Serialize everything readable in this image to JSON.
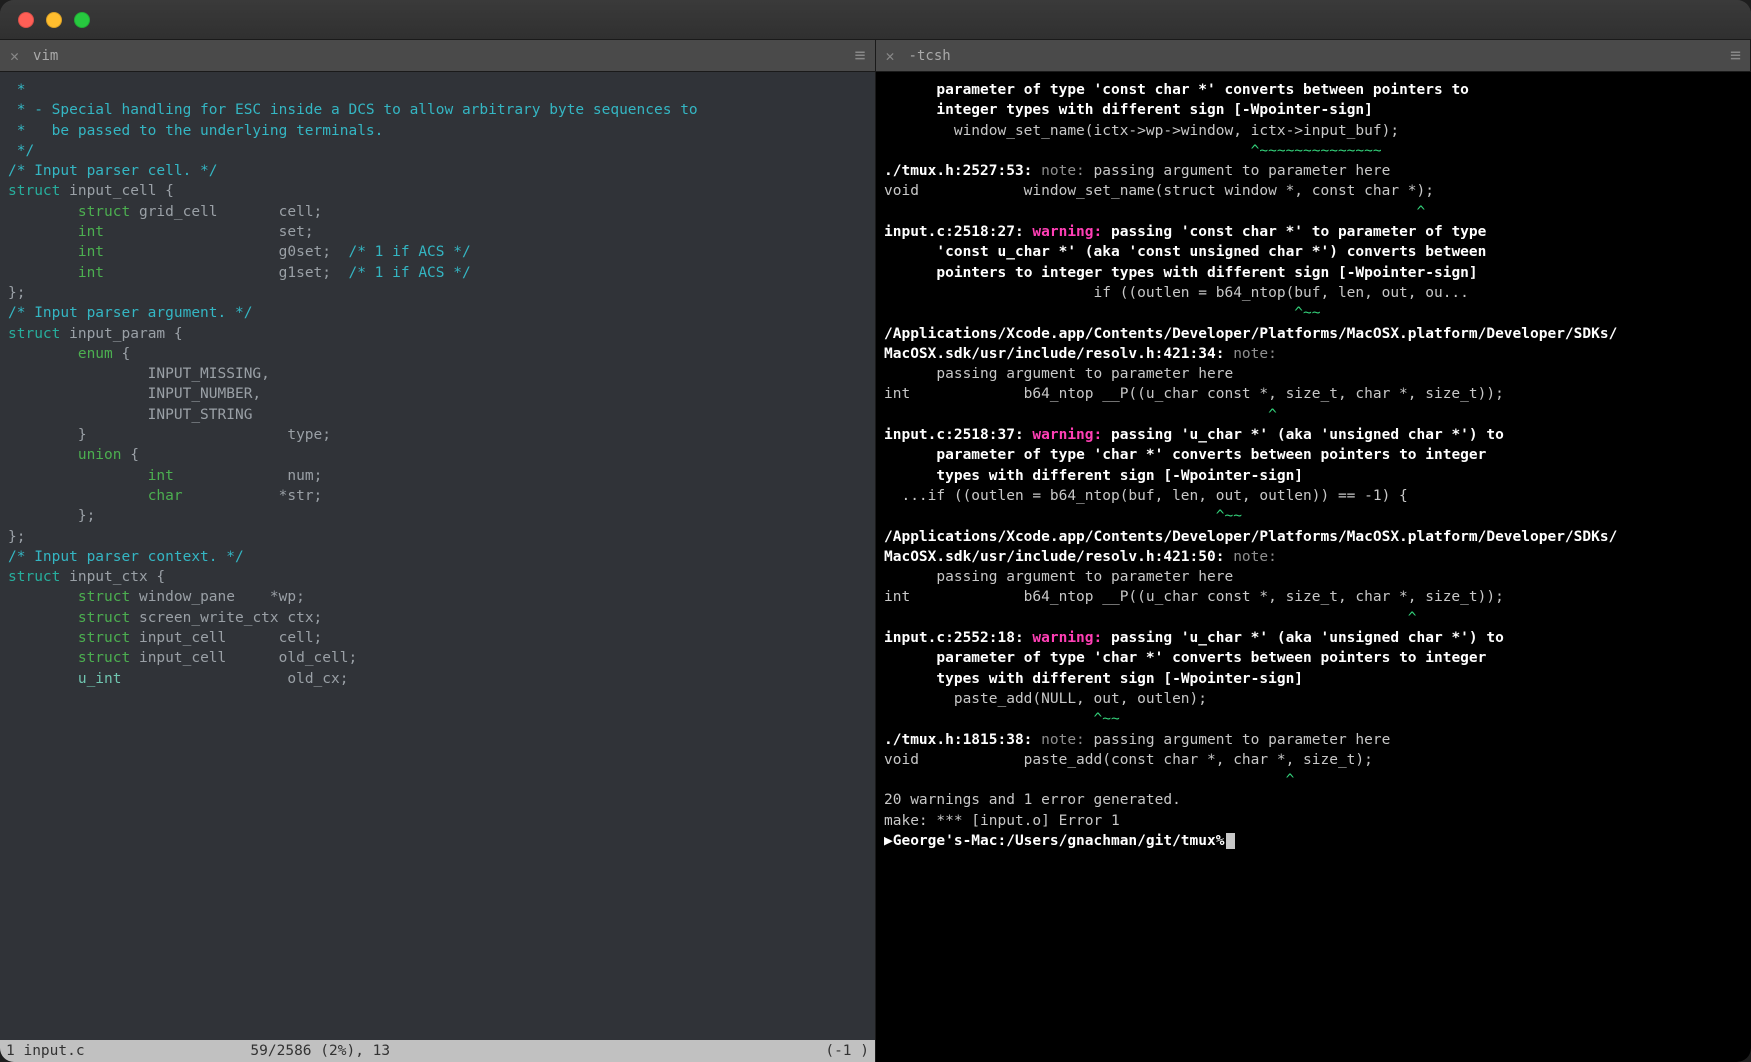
{
  "tabs": {
    "left_label": "vim",
    "right_label": "-tcsh"
  },
  "vim": {
    "code_lines": [
      {
        "class": "c-comment",
        "text": " *"
      },
      {
        "class": "c-comment",
        "text": " * - Special handling for ESC inside a DCS to allow arbitrary byte sequences to"
      },
      {
        "class": "c-comment",
        "text": " *   be passed to the underlying terminals."
      },
      {
        "class": "c-comment",
        "text": " */"
      },
      {
        "class": "",
        "text": ""
      },
      {
        "class": "c-comment",
        "text": "/* Input parser cell. */"
      },
      {
        "segments": [
          {
            "class": "c-struct",
            "text": "struct"
          },
          {
            "class": "c-gray",
            "text": " input_cell {"
          }
        ]
      },
      {
        "segments": [
          {
            "class": "",
            "text": "        "
          },
          {
            "class": "c-keyword",
            "text": "struct"
          },
          {
            "class": "c-gray",
            "text": " grid_cell       cell;"
          }
        ]
      },
      {
        "segments": [
          {
            "class": "",
            "text": "        "
          },
          {
            "class": "c-keyword",
            "text": "int"
          },
          {
            "class": "c-gray",
            "text": "                    set;"
          }
        ]
      },
      {
        "segments": [
          {
            "class": "",
            "text": "        "
          },
          {
            "class": "c-keyword",
            "text": "int"
          },
          {
            "class": "c-gray",
            "text": "                    g0set;  "
          },
          {
            "class": "c-comment",
            "text": "/* 1 if ACS */"
          }
        ]
      },
      {
        "segments": [
          {
            "class": "",
            "text": "        "
          },
          {
            "class": "c-keyword",
            "text": "int"
          },
          {
            "class": "c-gray",
            "text": "                    g1set;  "
          },
          {
            "class": "c-comment",
            "text": "/* 1 if ACS */"
          }
        ]
      },
      {
        "class": "c-gray",
        "text": "};"
      },
      {
        "class": "",
        "text": ""
      },
      {
        "class": "c-comment",
        "text": "/* Input parser argument. */"
      },
      {
        "segments": [
          {
            "class": "c-struct",
            "text": "struct"
          },
          {
            "class": "c-gray",
            "text": " input_param {"
          }
        ]
      },
      {
        "segments": [
          {
            "class": "",
            "text": "        "
          },
          {
            "class": "c-keyword",
            "text": "enum"
          },
          {
            "class": "c-gray",
            "text": " {"
          }
        ]
      },
      {
        "class": "c-gray",
        "text": "                INPUT_MISSING,"
      },
      {
        "class": "c-gray",
        "text": "                INPUT_NUMBER,"
      },
      {
        "class": "c-gray",
        "text": "                INPUT_STRING"
      },
      {
        "class": "c-gray",
        "text": "        }                       type;"
      },
      {
        "segments": [
          {
            "class": "",
            "text": "        "
          },
          {
            "class": "c-keyword",
            "text": "union"
          },
          {
            "class": "c-gray",
            "text": " {"
          }
        ]
      },
      {
        "segments": [
          {
            "class": "",
            "text": "                "
          },
          {
            "class": "c-keyword",
            "text": "int"
          },
          {
            "class": "c-gray",
            "text": "             num;"
          }
        ]
      },
      {
        "segments": [
          {
            "class": "",
            "text": "                "
          },
          {
            "class": "c-keyword",
            "text": "char"
          },
          {
            "class": "c-gray",
            "text": "           *str;"
          }
        ]
      },
      {
        "class": "c-gray",
        "text": "        };"
      },
      {
        "class": "c-gray",
        "text": "};"
      },
      {
        "class": "",
        "text": ""
      },
      {
        "class": "c-comment",
        "text": "/* Input parser context. */"
      },
      {
        "segments": [
          {
            "class": "c-struct",
            "text": "struct"
          },
          {
            "class": "c-gray",
            "text": " input_ctx {"
          }
        ]
      },
      {
        "segments": [
          {
            "class": "",
            "text": "        "
          },
          {
            "class": "c-keyword",
            "text": "struct"
          },
          {
            "class": "c-gray",
            "text": " window_pane    *wp;"
          }
        ]
      },
      {
        "segments": [
          {
            "class": "",
            "text": "        "
          },
          {
            "class": "c-keyword",
            "text": "struct"
          },
          {
            "class": "c-gray",
            "text": " screen_write_ctx ctx;"
          }
        ]
      },
      {
        "class": "",
        "text": ""
      },
      {
        "segments": [
          {
            "class": "",
            "text": "        "
          },
          {
            "class": "c-keyword",
            "text": "struct"
          },
          {
            "class": "c-gray",
            "text": " input_cell      cell;"
          }
        ]
      },
      {
        "class": "",
        "text": ""
      },
      {
        "segments": [
          {
            "class": "",
            "text": "        "
          },
          {
            "class": "c-keyword",
            "text": "struct"
          },
          {
            "class": "c-gray",
            "text": " input_cell      old_cell;"
          }
        ]
      },
      {
        "segments": [
          {
            "class": "",
            "text": "        "
          },
          {
            "class": "c-type2",
            "text": "u_int"
          },
          {
            "class": "c-gray",
            "text": "                   old_cx;"
          }
        ]
      }
    ],
    "status_left": "1 input.c                   59/2586 (2%), 13",
    "status_right": "(-1 )"
  },
  "shell": {
    "lines": [
      {
        "segments": [
          {
            "class": "",
            "text": "      "
          },
          {
            "class": "w-msg",
            "text": "parameter of type 'const char *' converts between pointers to"
          }
        ]
      },
      {
        "segments": [
          {
            "class": "",
            "text": "      "
          },
          {
            "class": "w-msg",
            "text": "integer types with different sign [-Wpointer-sign]"
          }
        ]
      },
      {
        "class": "w-code",
        "text": "        window_set_name(ictx->wp->window, ictx->input_buf);"
      },
      {
        "class": "w-hl",
        "text": "                                          ^~~~~~~~~~~~~~~"
      },
      {
        "segments": [
          {
            "class": "w-loc",
            "text": "./tmux.h:2527:53: "
          },
          {
            "class": "w-note",
            "text": "note: "
          },
          {
            "class": "w-code",
            "text": "passing argument to parameter here"
          }
        ]
      },
      {
        "class": "w-code",
        "text": "void            window_set_name(struct window *, const char *);"
      },
      {
        "class": "w-hl",
        "text": "                                                             ^"
      },
      {
        "segments": [
          {
            "class": "w-loc",
            "text": "input.c:2518:27: "
          },
          {
            "class": "w-warn",
            "text": "warning: "
          },
          {
            "class": "w-msg",
            "text": "passing 'const char *' to parameter of type"
          }
        ]
      },
      {
        "segments": [
          {
            "class": "",
            "text": "      "
          },
          {
            "class": "w-msg",
            "text": "'const u_char *' (aka 'const unsigned char *') converts between"
          }
        ]
      },
      {
        "segments": [
          {
            "class": "",
            "text": "      "
          },
          {
            "class": "w-msg",
            "text": "pointers to integer types with different sign [-Wpointer-sign]"
          }
        ]
      },
      {
        "class": "w-code",
        "text": "                        if ((outlen = b64_ntop(buf, len, out, ou..."
      },
      {
        "class": "w-hl",
        "text": "                                               ^~~"
      },
      {
        "class": "w-msg",
        "text": "/Applications/Xcode.app/Contents/Developer/Platforms/MacOSX.platform/Developer/SDKs/"
      },
      {
        "segments": [
          {
            "class": "w-loc",
            "text": "MacOSX.sdk/usr/include/resolv.h:421:34: "
          },
          {
            "class": "w-note",
            "text": "note:"
          }
        ]
      },
      {
        "class": "w-code",
        "text": "      passing argument to parameter here"
      },
      {
        "class": "w-code",
        "text": "int             b64_ntop __P((u_char const *, size_t, char *, size_t));"
      },
      {
        "class": "w-hl",
        "text": "                                            ^"
      },
      {
        "segments": [
          {
            "class": "w-loc",
            "text": "input.c:2518:37: "
          },
          {
            "class": "w-warn",
            "text": "warning: "
          },
          {
            "class": "w-msg",
            "text": "passing 'u_char *' (aka 'unsigned char *') to"
          }
        ]
      },
      {
        "segments": [
          {
            "class": "",
            "text": "      "
          },
          {
            "class": "w-msg",
            "text": "parameter of type 'char *' converts between pointers to integer"
          }
        ]
      },
      {
        "segments": [
          {
            "class": "",
            "text": "      "
          },
          {
            "class": "w-msg",
            "text": "types with different sign [-Wpointer-sign]"
          }
        ]
      },
      {
        "class": "w-code",
        "text": "  ...if ((outlen = b64_ntop(buf, len, out, outlen)) == -1) {"
      },
      {
        "class": "w-hl",
        "text": "                                      ^~~"
      },
      {
        "class": "w-msg",
        "text": "/Applications/Xcode.app/Contents/Developer/Platforms/MacOSX.platform/Developer/SDKs/"
      },
      {
        "segments": [
          {
            "class": "w-loc",
            "text": "MacOSX.sdk/usr/include/resolv.h:421:50: "
          },
          {
            "class": "w-note",
            "text": "note:"
          }
        ]
      },
      {
        "class": "w-code",
        "text": "      passing argument to parameter here"
      },
      {
        "class": "w-code",
        "text": "int             b64_ntop __P((u_char const *, size_t, char *, size_t));"
      },
      {
        "class": "w-hl",
        "text": "                                                            ^"
      },
      {
        "segments": [
          {
            "class": "w-loc",
            "text": "input.c:2552:18: "
          },
          {
            "class": "w-warn",
            "text": "warning: "
          },
          {
            "class": "w-msg",
            "text": "passing 'u_char *' (aka 'unsigned char *') to"
          }
        ]
      },
      {
        "segments": [
          {
            "class": "",
            "text": "      "
          },
          {
            "class": "w-msg",
            "text": "parameter of type 'char *' converts between pointers to integer"
          }
        ]
      },
      {
        "segments": [
          {
            "class": "",
            "text": "      "
          },
          {
            "class": "w-msg",
            "text": "types with different sign [-Wpointer-sign]"
          }
        ]
      },
      {
        "class": "w-code",
        "text": "        paste_add(NULL, out, outlen);"
      },
      {
        "class": "w-hl",
        "text": "                        ^~~"
      },
      {
        "segments": [
          {
            "class": "w-loc",
            "text": "./tmux.h:1815:38: "
          },
          {
            "class": "w-note",
            "text": "note: "
          },
          {
            "class": "w-code",
            "text": "passing argument to parameter here"
          }
        ]
      },
      {
        "class": "w-code",
        "text": "void            paste_add(const char *, char *, size_t);"
      },
      {
        "class": "w-hl",
        "text": "                                              ^"
      },
      {
        "class": "w-code",
        "text": "20 warnings and 1 error generated."
      },
      {
        "class": "w-code",
        "text": "make: *** [input.o] Error 1"
      }
    ],
    "prompt": "▶George's-Mac:/Users/gnachman/git/tmux%"
  }
}
